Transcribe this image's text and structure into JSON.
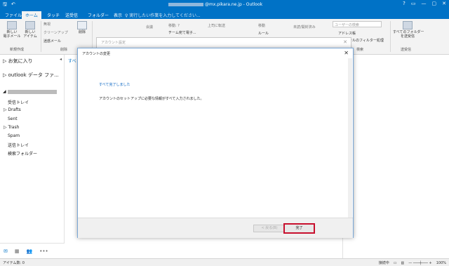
{
  "window": {
    "title_suffix": "@mx.pikara.ne.jp - Outlook",
    "qa_icons": [
      "save-icon",
      "undo-icon"
    ],
    "controls": [
      "?",
      "▭",
      "—",
      "▢",
      "✕"
    ]
  },
  "tabs": [
    {
      "label": "ファイル"
    },
    {
      "label": "ホーム"
    },
    {
      "label": "タッチ"
    },
    {
      "label": "送受信"
    },
    {
      "label": "フォルダー"
    },
    {
      "label": "表示"
    }
  ],
  "tellme": "♀ 実行したい作業を入力してください...",
  "ribbon": {
    "new_mail": "新しい\n電子メール",
    "new_items": "新しい\nアイテム",
    "group_new": "新規作成",
    "ignore": "無視",
    "cleanup": "クリーンアップ",
    "junk": "迷惑メール",
    "delete": "削除",
    "group_delete": "削除",
    "meeting": "会議",
    "moveto": "移動: ?",
    "team_email": "チーム宛て電子...",
    "to_manager": "上司に転送",
    "move": "移動",
    "rules": "ルール",
    "unread": "未読/開封済み",
    "search_people": "ユーザーの検索",
    "address_book": "アドレス帳",
    "filter_email": "電子メールのフィルター処理",
    "group_find": "検索",
    "send_receive_all": "すべてのフォルダー\nを送受信",
    "group_send_receive": "送受信"
  },
  "left": {
    "favorites": "お気に入り",
    "outlook_data": "outlook データ ファ...",
    "folders": [
      "受信トレイ",
      "Drafts",
      "Sent",
      "Trash",
      "Spam",
      "送信トレイ",
      "検索フォルダー"
    ]
  },
  "list": {
    "tab_all": "すべ"
  },
  "status": {
    "items": "アイテム数: 0",
    "connected": "接続中",
    "zoom": "100%"
  },
  "behind_dialog": {
    "title": "アカウント設定"
  },
  "dialog": {
    "title": "アカウントの変更",
    "heading": "すべて完了しました",
    "message": "アカウントのセットアップに必要な情報がすべて入力されました。",
    "back": "< 戻る(B)",
    "finish": "完了"
  },
  "colors": {
    "accent": "#0072c6",
    "highlight": "#c8102e"
  }
}
